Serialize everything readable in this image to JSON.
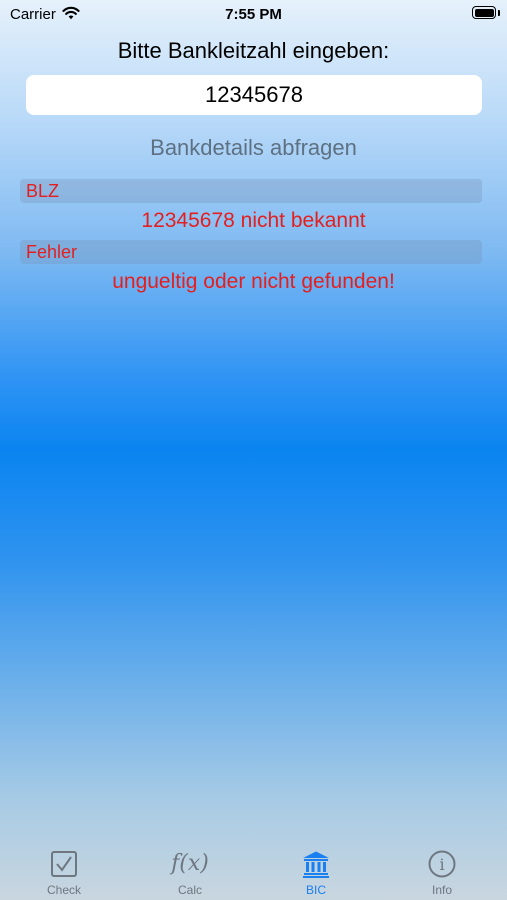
{
  "status_bar": {
    "carrier": "Carrier",
    "time": "7:55 PM"
  },
  "form": {
    "prompt": "Bitte Bankleitzahl eingeben:",
    "blz_value": "12345678",
    "lookup_label": "Bankdetails abfragen"
  },
  "results": [
    {
      "header": "BLZ",
      "value": "12345678 nicht bekannt"
    },
    {
      "header": "Fehler",
      "value": "ungueltig oder nicht gefunden!"
    }
  ],
  "tabs": [
    {
      "label": "Check",
      "icon": "checkbox-icon"
    },
    {
      "label": "Calc",
      "icon": "function-icon",
      "glyph": "f(x)"
    },
    {
      "label": "BIC",
      "icon": "bank-icon"
    },
    {
      "label": "Info",
      "icon": "info-icon",
      "glyph": "i"
    }
  ],
  "colors": {
    "accent": "#1a7ff0",
    "error": "#e31f1f",
    "tab_inactive": "#6e7780"
  }
}
